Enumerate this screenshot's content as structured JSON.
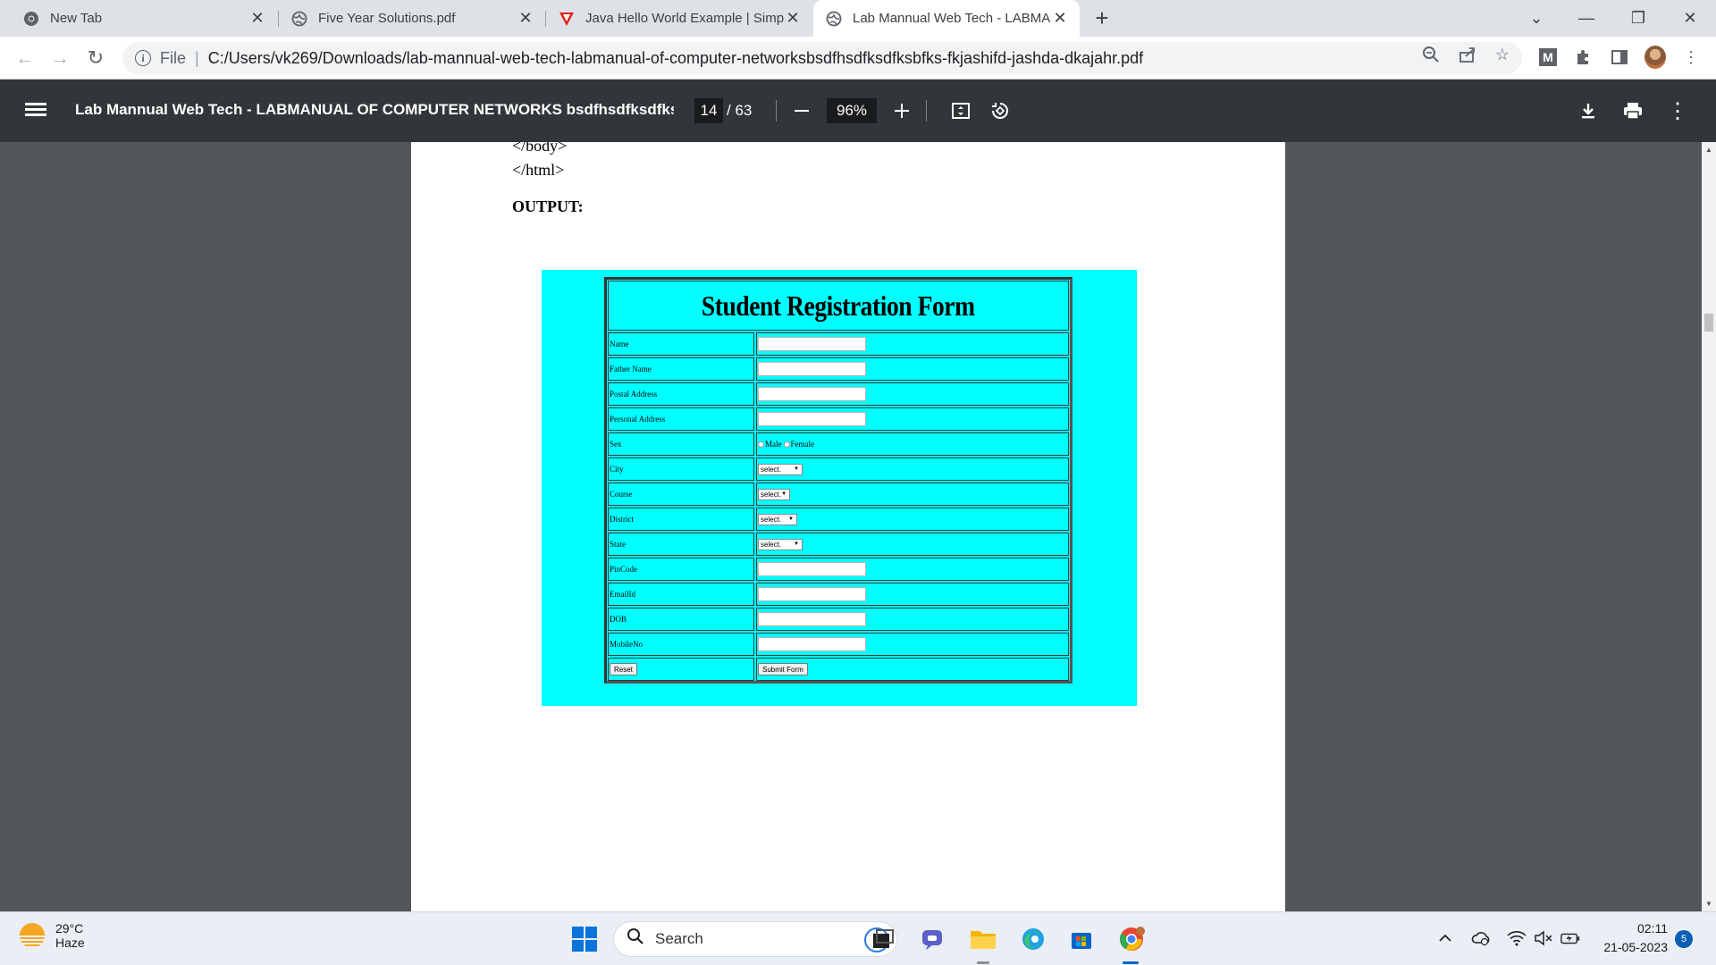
{
  "browser": {
    "tabs": [
      {
        "title": "New Tab",
        "icon": "chrome-icon",
        "active": false
      },
      {
        "title": "Five Year Solutions.pdf",
        "icon": "globe-icon",
        "active": false
      },
      {
        "title": "Java Hello World Example | Simpl",
        "icon": "v-brand-icon",
        "active": false
      },
      {
        "title": "Lab Mannual Web Tech - LABMA",
        "icon": "globe-icon",
        "active": true
      }
    ],
    "new_tab_label": "+",
    "address": {
      "scheme_label": "File",
      "url": "C:/Users/vk269/Downloads/lab-mannual-web-tech-labmanual-of-computer-networksbsdfhsdfksdfksbfks-fkjashifd-jashda-dkajahr.pdf"
    },
    "extension_letter": "M"
  },
  "pdf_toolbar": {
    "title": "Lab Mannual Web Tech - LABMANUAL OF COMPUTER NETWORKS bsdfhsdfksdfksb...",
    "current_page": "14",
    "page_total": "/ 63",
    "zoom": "96%"
  },
  "document": {
    "code_lines": [
      "</body>",
      "</html>"
    ],
    "output_label": "OUTPUT:",
    "form": {
      "title": "Student Registration Form",
      "rows": [
        {
          "label": "Name",
          "type": "text"
        },
        {
          "label": "Father Name",
          "type": "text"
        },
        {
          "label": "Postal Address",
          "type": "text"
        },
        {
          "label": "Personal Address",
          "type": "text"
        },
        {
          "label": "Sex",
          "type": "radio"
        },
        {
          "label": "City",
          "type": "select"
        },
        {
          "label": "Course",
          "type": "select"
        },
        {
          "label": "District",
          "type": "select"
        },
        {
          "label": "State",
          "type": "select"
        },
        {
          "label": "PinCode",
          "type": "text"
        },
        {
          "label": "EmailId",
          "type": "text"
        },
        {
          "label": "DOB",
          "type": "text"
        },
        {
          "label": "MobileNo",
          "type": "text"
        }
      ],
      "sex_options": [
        "Male",
        "Female"
      ],
      "select_placeholder": "select.",
      "reset_label": "Reset",
      "submit_label": "Submit Form"
    }
  },
  "taskbar": {
    "weather_temp": "29°C",
    "weather_desc": "Haze",
    "search_placeholder": "Search",
    "time": "02:11",
    "date": "21-05-2023",
    "notification_count": "5"
  },
  "colors": {
    "output_bg": "#00ffff",
    "pdf_toolbar_bg": "#323639",
    "viewer_bg": "#525659",
    "tabstrip_bg": "#dee1e6"
  }
}
